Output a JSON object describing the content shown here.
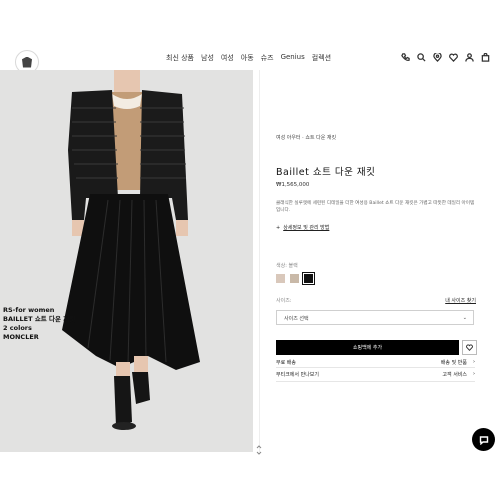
{
  "header": {
    "nav": [
      "최신 상품",
      "남성",
      "여성",
      "아동",
      "슈즈",
      "Genius",
      "컬렉션"
    ],
    "icons": [
      "phone-icon",
      "search-icon",
      "location-icon",
      "heart-icon",
      "user-icon",
      "bag-icon"
    ]
  },
  "photo_caption": [
    "RS-for women",
    "BAILLET 쇼트 다운 재킷",
    "2 colors",
    "MONCLER"
  ],
  "product": {
    "breadcrumb": "여성 아우터  ·  쇼트 다운 재킷",
    "title": "Baillet 쇼트 다운 재킷",
    "price": "₩1,565,000",
    "description": "클래식한 실루엣에 세련된 디테일을 더한 여성용 Baillet 쇼트 다운 재킷은 가볍고 따뜻한 데일리 아이템입니다.",
    "care_link": "상세정보 및 관리 방법",
    "color_label": "색상: 블랙",
    "swatches": [
      "#d9c8bb",
      "#c9b9a8",
      "#111111"
    ],
    "size_label": "사이즈:",
    "size_guide": "내 사이즈 찾기",
    "size_select": "사이즈 선택",
    "add_to_cart": "쇼핑백에 추가",
    "rows": [
      {
        "left": "무료 배송",
        "right": "배송 및 반품"
      },
      {
        "left": "부티크에서 만나보기",
        "right": "고객 서비스"
      }
    ]
  }
}
